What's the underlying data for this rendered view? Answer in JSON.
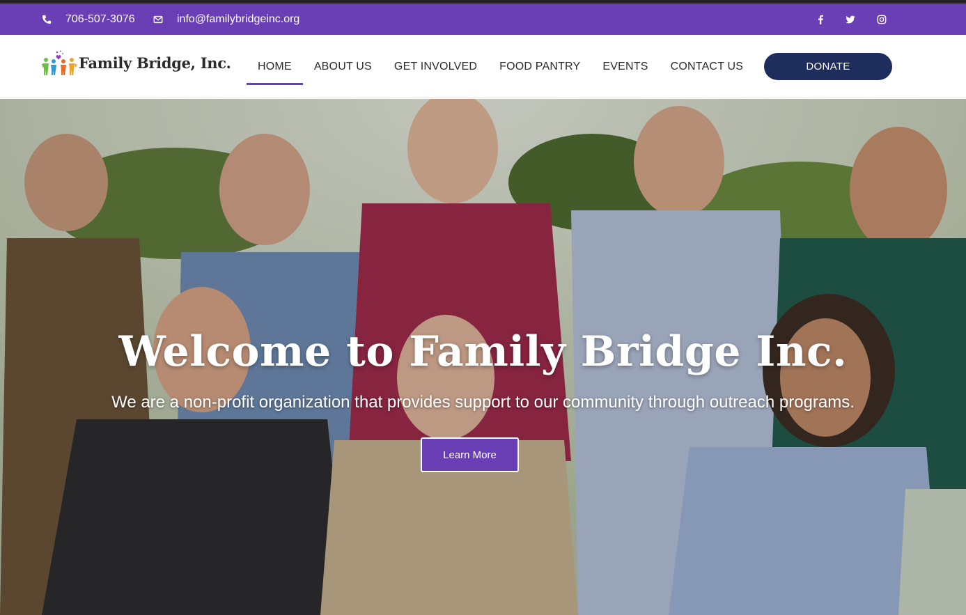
{
  "contact": {
    "phone": "706-507-3076",
    "email": "info@familybridgeinc.org"
  },
  "social": [
    "facebook-icon",
    "twitter-icon",
    "instagram-icon"
  ],
  "brand": {
    "name": "Family Bridge, Inc.",
    "accent_color": "#6a3fb5",
    "button_color": "#1f2d5c"
  },
  "nav": {
    "items": [
      {
        "label": "HOME",
        "active": true
      },
      {
        "label": "ABOUT US"
      },
      {
        "label": "GET INVOLVED"
      },
      {
        "label": "FOOD PANTRY"
      },
      {
        "label": "EVENTS"
      },
      {
        "label": "CONTACT US"
      }
    ],
    "donate_label": "DONATE"
  },
  "hero": {
    "title": "Welcome to Family Bridge Inc.",
    "subtitle": "We are a non-profit organization that provides support to our community through outreach programs.",
    "cta_label": "Learn More"
  }
}
